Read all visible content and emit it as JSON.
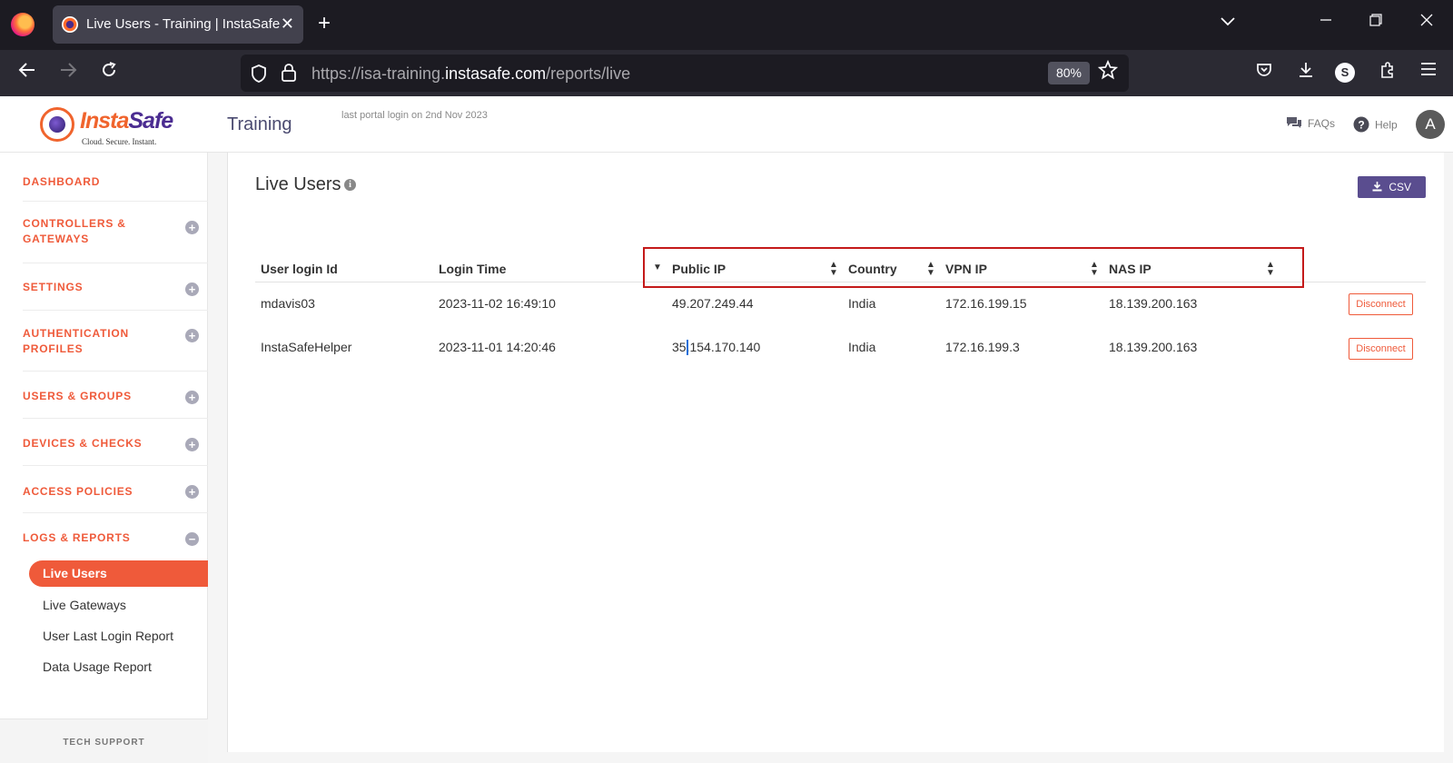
{
  "browser": {
    "tab_title": "Live Users - Training | InstaSafe",
    "tab_close": "✕",
    "new_tab": "+",
    "url_prefix": "https://isa-training.",
    "url_host": "instasafe.com",
    "url_path": "/reports/live",
    "zoom": "80%",
    "profile_initial": "S"
  },
  "header": {
    "logo_insta": "Insta",
    "logo_safe": "Safe",
    "logo_tagline": "Cloud. Secure. Instant.",
    "portal_name": "Training",
    "last_login": "last portal login on 2nd Nov 2023",
    "faqs": "FAQs",
    "help": "Help",
    "user_initial": "A"
  },
  "sidebar": {
    "items": [
      {
        "label": "DASHBOARD"
      },
      {
        "label_line1": "CONTROLLERS &",
        "label_line2": "GATEWAYS"
      },
      {
        "label": "SETTINGS"
      },
      {
        "label_line1": "AUTHENTICATION",
        "label_line2": "PROFILES"
      },
      {
        "label": "USERS & GROUPS"
      },
      {
        "label": "DEVICES & CHECKS"
      },
      {
        "label": "ACCESS POLICIES"
      },
      {
        "label": "LOGS & REPORTS"
      }
    ],
    "sub_items": [
      "Live Users",
      "Live Gateways",
      "User Last Login Report",
      "Data Usage Report"
    ],
    "tech_support": "TECH SUPPORT"
  },
  "main": {
    "title": "Live Users",
    "csv_label": "CSV",
    "columns": [
      "User login Id",
      "Login Time",
      "Public IP",
      "Country",
      "VPN IP",
      "NAS IP"
    ],
    "rows": [
      {
        "user": "mdavis03",
        "login_time": "2023-11-02 16:49:10",
        "public_ip": "49.207.249.44",
        "country": "India",
        "vpn_ip": "172.16.199.15",
        "nas_ip": "18.139.200.163",
        "action": "Disconnect"
      },
      {
        "user": "InstaSafeHelper",
        "login_time": "2023-11-01 14:20:46",
        "public_ip": "35.154.170.140",
        "country": "India",
        "vpn_ip": "172.16.199.3",
        "nas_ip": "18.139.200.163",
        "action": "Disconnect"
      }
    ]
  },
  "colors": {
    "accent": "#ef5a3a",
    "brand_purple": "#5a4d8f",
    "highlight_box": "#c41a1a"
  }
}
